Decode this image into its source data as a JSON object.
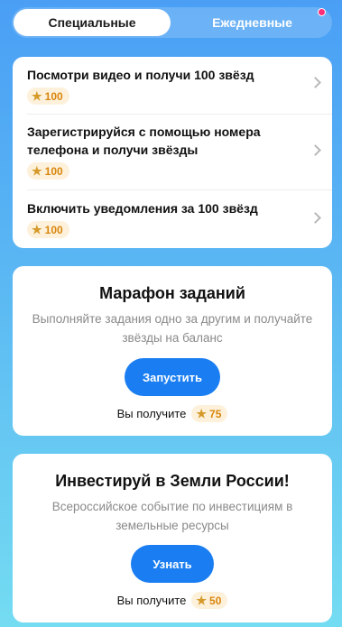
{
  "tabs": [
    {
      "label": "Специальные",
      "active": true
    },
    {
      "label": "Ежедневные",
      "active": false
    }
  ],
  "tasks": [
    {
      "title": "Посмотри видео и получи 100 звёзд",
      "reward": "100"
    },
    {
      "title": "Зарегистрируйся с помощью номера телефона и получи звёзды",
      "reward": "100"
    },
    {
      "title": "Включить уведомления за 100 звёзд",
      "reward": "100"
    }
  ],
  "marathon": {
    "title": "Марафон заданий",
    "description": "Выполняйте задания одно за другим и получайте звёзды на баланс",
    "button": "Запустить",
    "reward_label": "Вы получите",
    "reward": "75"
  },
  "invest": {
    "title": "Инвестируй в Земли России!",
    "description": "Всероссийское событие по инвестициям в земельные ресурсы",
    "button": "Узнать",
    "reward_label": "Вы получите",
    "reward": "50"
  },
  "colors": {
    "accent": "#1a7ef2",
    "badge_bg": "#fdf1dc",
    "badge_text": "#d9860c",
    "notification_dot": "#ff2d78"
  },
  "icons": {
    "star": "star-icon",
    "chevron": "chevron-right-icon"
  }
}
